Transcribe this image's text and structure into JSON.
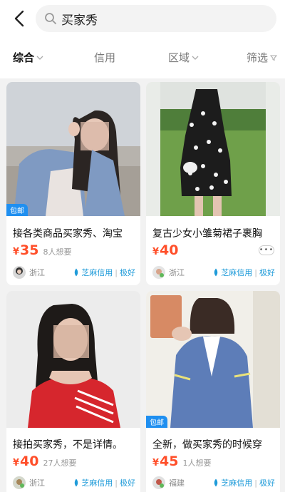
{
  "search": {
    "query": "买家秀"
  },
  "filters": [
    {
      "label": "综合",
      "active": true
    },
    {
      "label": "信用",
      "active": false
    },
    {
      "label": "区域",
      "active": false
    },
    {
      "label": "筛选",
      "active": false
    }
  ],
  "items": [
    {
      "title": "接各类商品买家秀、淘宝",
      "yen": "¥",
      "price": "35",
      "want": "8人想要",
      "badge": "包邮",
      "location": "浙江",
      "credit": "芝麻信用",
      "credit_level": "极好"
    },
    {
      "title": "复古少女小雏菊裙子裹胸",
      "yen": "¥",
      "price": "40",
      "want": "",
      "badge": "",
      "location": "浙江",
      "credit": "芝麻信用",
      "credit_level": "极好"
    },
    {
      "title": "接拍买家秀，不是详情。",
      "yen": "¥",
      "price": "40",
      "want": "27人想要",
      "badge": "",
      "location": "浙江",
      "credit": "芝麻信用",
      "credit_level": "极好"
    },
    {
      "title": "全新，做买家秀的时候穿",
      "yen": "¥",
      "price": "45",
      "want": "1人想要",
      "badge": "包邮",
      "location": "福建",
      "credit": "芝麻信用",
      "credit_level": "极好"
    }
  ],
  "colors": {
    "price": "#ff4f2a",
    "credit": "#1f9bd9",
    "badge": "#1f8ff0"
  },
  "icons": [
    "back-arrow-icon",
    "search-icon",
    "chevron-down-icon",
    "filter-icon",
    "sesame-credit-icon",
    "more-icon"
  ]
}
